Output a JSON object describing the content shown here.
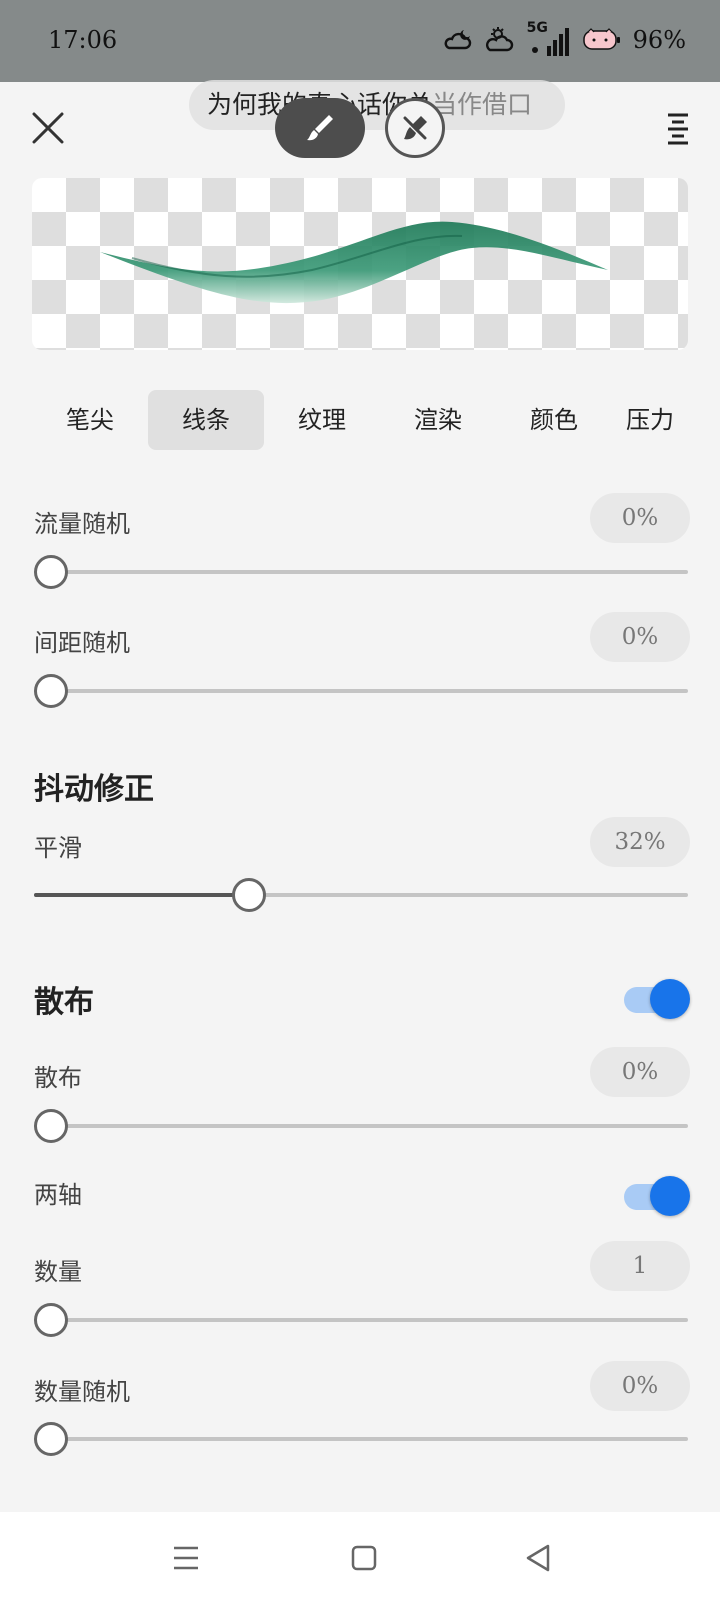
{
  "status_bar": {
    "time": "17:06",
    "network": "5G",
    "battery": "96%"
  },
  "toast": {
    "text": "为何我的真心话你总",
    "text_faded": "当作借口"
  },
  "preview": {
    "stroke_color": "#2e8b6a"
  },
  "tabs": [
    {
      "label": "笔尖",
      "active": false
    },
    {
      "label": "线条",
      "active": true
    },
    {
      "label": "纹理",
      "active": false
    },
    {
      "label": "渲染",
      "active": false
    },
    {
      "label": "颜色",
      "active": false
    },
    {
      "label": "压力",
      "active": false
    }
  ],
  "settings": {
    "flow_random": {
      "label": "流量随机",
      "value": "0%",
      "level": 0
    },
    "spacing_random": {
      "label": "间距随机",
      "value": "0%",
      "level": 0
    },
    "stabilization_title": "抖动修正",
    "smooth": {
      "label": "平滑",
      "value": "32%",
      "level": 0.32
    },
    "scatter_title": "散布",
    "scatter_enabled": true,
    "scatter": {
      "label": "散布",
      "value": "0%",
      "level": 0
    },
    "both_axes": {
      "label": "两轴",
      "enabled": true
    },
    "count": {
      "label": "数量",
      "value": "1",
      "level": 0
    },
    "count_random": {
      "label": "数量随机",
      "value": "0%",
      "level": 0
    }
  },
  "colors": {
    "accent": "#1874ea",
    "accent_light": "#a9cbf5"
  }
}
